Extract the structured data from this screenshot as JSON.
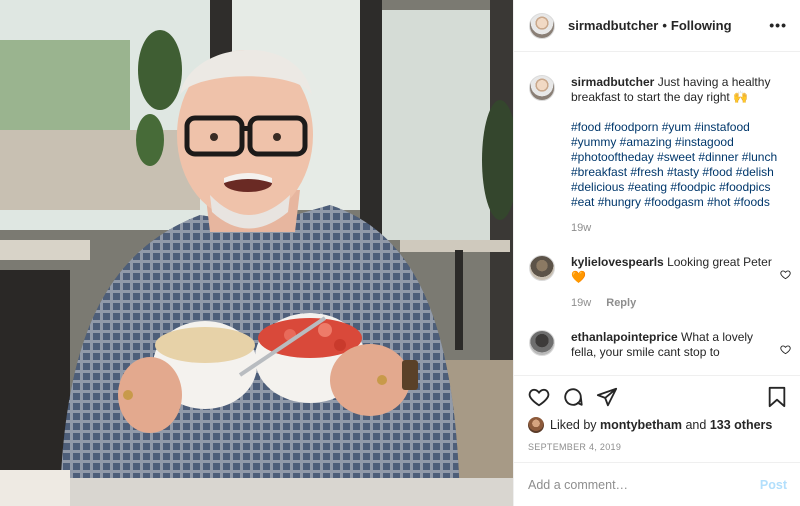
{
  "post": {
    "author": "sirmadbutcher",
    "separator": "•",
    "follow_status": "Following",
    "more_label": "•••"
  },
  "caption": {
    "username": "sirmadbutcher",
    "text": "Just having a healthy breakfast to start the day right 🙌",
    "hashtags": "#food #foodporn #yum #instafood #yummy #amazing #instagood #photooftheday #sweet #dinner #lunch #breakfast #fresh #tasty #food #delish #delicious #eating #foodpic #foodpics #eat #hungry #foodgasm #hot #foods",
    "time": "19w"
  },
  "comments": [
    {
      "username": "kylielovespearls",
      "text": "Looking great Peter 🧡",
      "time": "19w",
      "reply_label": "Reply"
    },
    {
      "username": "ethanlapointeprice",
      "text": "What a lovely fella, your smile cant stop to"
    }
  ],
  "likes": {
    "prefix": "Liked by",
    "user": "montybetham",
    "joiner": "and",
    "others": "133 others"
  },
  "date": "September 4, 2019",
  "composer": {
    "placeholder": "Add a comment…",
    "post_label": "Post"
  },
  "colors": {
    "hashtag": "#00376b",
    "post_disabled": "#b2dffc",
    "muted": "#8e8e8e",
    "heart_emoji": "#e8622c"
  },
  "icons": [
    "heart-icon",
    "comment-icon",
    "share-icon",
    "bookmark-icon",
    "more-icon"
  ]
}
